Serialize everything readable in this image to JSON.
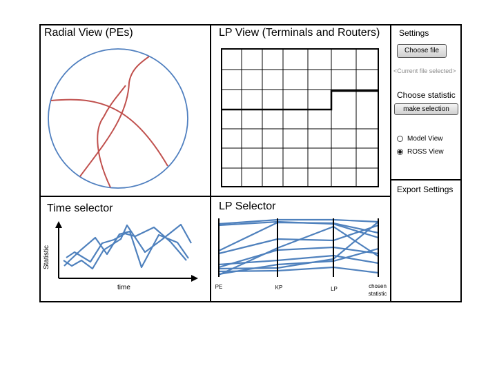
{
  "radial_view": {
    "title": "Radial View (PEs)"
  },
  "lp_view": {
    "title": "LP View (Terminals and Routers)"
  },
  "settings": {
    "title": "Settings",
    "choose_file_label": "Choose file",
    "current_file_hint": "<Current file selected>",
    "choose_statistic_label": "Choose statistic",
    "make_selection_label": "make selection",
    "view_options": [
      {
        "label": "Model View",
        "selected": false
      },
      {
        "label": "ROSS View",
        "selected": true
      }
    ]
  },
  "export_settings": {
    "title": "Export Settings"
  },
  "time_selector": {
    "title": "Time selector",
    "y_axis_label": "Statistic",
    "x_axis_label": "time"
  },
  "lp_selector": {
    "title": "LP Selector",
    "axes": [
      "PE",
      "KP",
      "LP",
      "chosen statistic"
    ],
    "axis_label_lines": [
      [
        "PE"
      ],
      [
        "KP"
      ],
      [
        "LP"
      ],
      [
        "chosen",
        "statistic"
      ]
    ]
  },
  "colors": {
    "circle": "#4f7fbf",
    "curve": "#c0504d",
    "series": "#4f81bd",
    "border": "#000000"
  }
}
